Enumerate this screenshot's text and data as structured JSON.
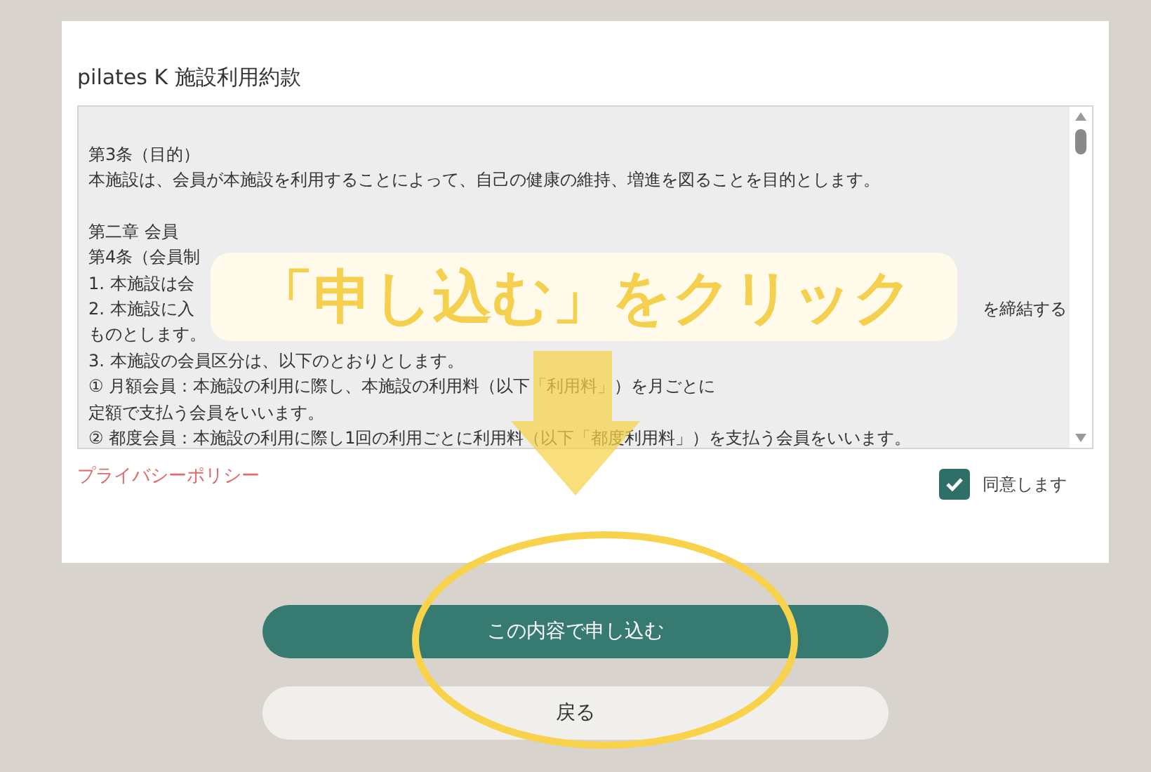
{
  "title": "pilates K 施設利用約款",
  "terms": {
    "paragraphs": [
      {
        "lines": [
          {
            "text": "第3条（目的）"
          },
          {
            "text": "本施設は、会員が本施設を利用することによって、自己の健康の維持、増進を図ることを目的とします。"
          }
        ]
      },
      {
        "lines": [
          {
            "text": "第二章 会員"
          },
          {
            "text": "第4条（会員制"
          },
          {
            "text": "1. 本施設は会"
          },
          {
            "text": "2. 本施設に入",
            "tail": "を締結する"
          },
          {
            "text": "ものとします。"
          },
          {
            "text": "3. 本施設の会員区分は、以下のとおりとします。"
          },
          {
            "text": "① 月額会員：本施設の利用に際し、本施設の利用料（以下「利用料」）を月ごとに"
          },
          {
            "text": "定額で支払う会員をいいます。"
          },
          {
            "text": "② 都度会員：本施設の利用に際し1回の利用ごとに利用料（以下「都度利用料」）を支払う会員をいいます。"
          }
        ]
      }
    ]
  },
  "privacy_link": "プライバシーポリシー",
  "agree": {
    "label": "同意します",
    "checked": true
  },
  "buttons": [
    {
      "label": "この内容で申し込む",
      "kind": "primary"
    },
    {
      "label": "戻る",
      "kind": "secondary"
    }
  ],
  "annotation": {
    "callout": "「申し込む」をクリック"
  }
}
